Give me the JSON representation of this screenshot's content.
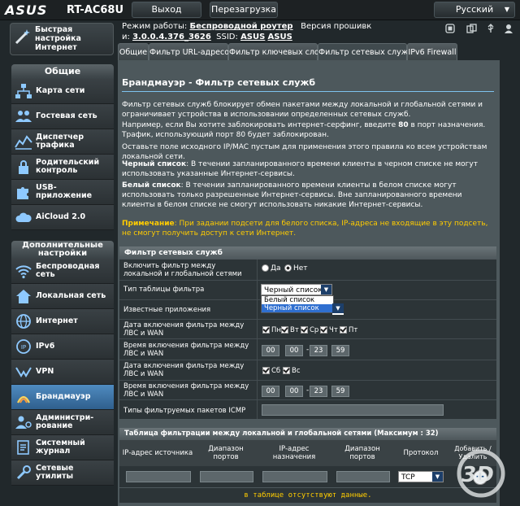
{
  "header": {
    "logo": "ASUS",
    "model": "RT-AC68U",
    "logout_label": "Выход",
    "reboot_label": "Перезагрузка",
    "language_label": "Русский"
  },
  "info": {
    "mode_label": "Режим работы:",
    "mode_value": "Беспроводной роутер",
    "firmware_label": "Версия прошивк",
    "firmware_label_suffix": "и:",
    "firmware_value": "3.0.0.4.376_3626",
    "ssid_label": "SSID:",
    "ssid_values": [
      "ASUS",
      "ASUS"
    ]
  },
  "sidebar": {
    "quick_setup": "Быстрая настройка Интернет",
    "section_general": "Общие",
    "general_items": [
      "Карта сети",
      "Гостевая сеть",
      "Диспетчер трафика",
      "Родительский контроль",
      "USB-приложение",
      "AiCloud 2.0"
    ],
    "section_advanced": "Дополнительные настройки",
    "advanced_items": [
      "Беспроводная сеть",
      "Локальная сеть",
      "Интернет",
      "IPv6",
      "VPN",
      "Брандмауэр",
      "Администри-рование",
      "Системный журнал",
      "Сетевые утилиты"
    ]
  },
  "tabs": [
    "Общие",
    "Фильтр URL-адресов",
    "Фильтр ключевых слов",
    "Фильтр сетевых служб",
    "IPv6 Firewall"
  ],
  "page": {
    "title": "Брандмауэр - Фильтр сетевых служб",
    "desc1": "Фильтр сетевых служб блокирует обмен пакетами между локальной и глобальной сетями и ограничивает устройства в использовании определенных сетевых служб.",
    "desc2_pre": "Например, если Вы хотите заблокировать интернет-серфинг, введите ",
    "desc2_port": "80",
    "desc2_post": " в порт назначения. Трафик, использующий порт 80 будет заблокирован.",
    "desc3": "Оставьте поле исходного IP/MAC пустым для применения этого правила ко всем устройствам локальной сети.",
    "black_label": "Черный список",
    "black_text": ": В течении запланированного времени клиенты в черном списке не могут использовать указанные Интернет-сервисы.",
    "white_label": "Белый список",
    "white_text": ": В течении запланированного времени клиенты в белом списке могут использовать только разрешенные Интернет-сервисы. Вне запланированного времени клиенты в белом списке не смогут использовать никакие Интернет-сервисы.",
    "note_label": "Примечание",
    "note_text": ": При задании подсети для белого списка, IP-адреса не входящие в эту подсеть, не смогут получить доступ к сети Интернет."
  },
  "form": {
    "header": "Фильтр сетевых служб",
    "enable_label": "Включить фильтр между локальной и глобальной сетями",
    "yes": "Да",
    "no": "Нет",
    "table_type_label": "Тип таблицы фильтра",
    "table_type_value": "Черный список",
    "table_type_options": [
      "Белый список",
      "Черный список"
    ],
    "apps_label": "Известные приложения",
    "days1_label": "Дата включения фильтра между ЛВС и WAN",
    "days1": [
      "Пн",
      "Вт",
      "Ср",
      "Чт",
      "Пт"
    ],
    "time1_label": "Время включения фильтра между ЛВС и WAN",
    "time1": [
      "00",
      "00",
      "23",
      "59"
    ],
    "days2_label": "Дата включения фильтра между ЛВС и WAN",
    "days2": [
      "Сб",
      "Вс"
    ],
    "time2_label": "Время включения фильтра между ЛВС и WAN",
    "time2": [
      "00",
      "00",
      "23",
      "59"
    ],
    "icmp_label": "Типы фильтруемых пакетов ICMP"
  },
  "list": {
    "header": "Таблица фильтрации между локальной и глобальной сетями (Максимум : 32)",
    "columns": [
      "IP-адрес источника",
      "Диапазон портов",
      "IP-адрес назначения",
      "Диапазон портов",
      "Протокол",
      "Добавить / Удалить"
    ],
    "protocol_value": "TCP",
    "empty_text": "в таблице отсутствуют данные."
  },
  "watermark": "3D"
}
